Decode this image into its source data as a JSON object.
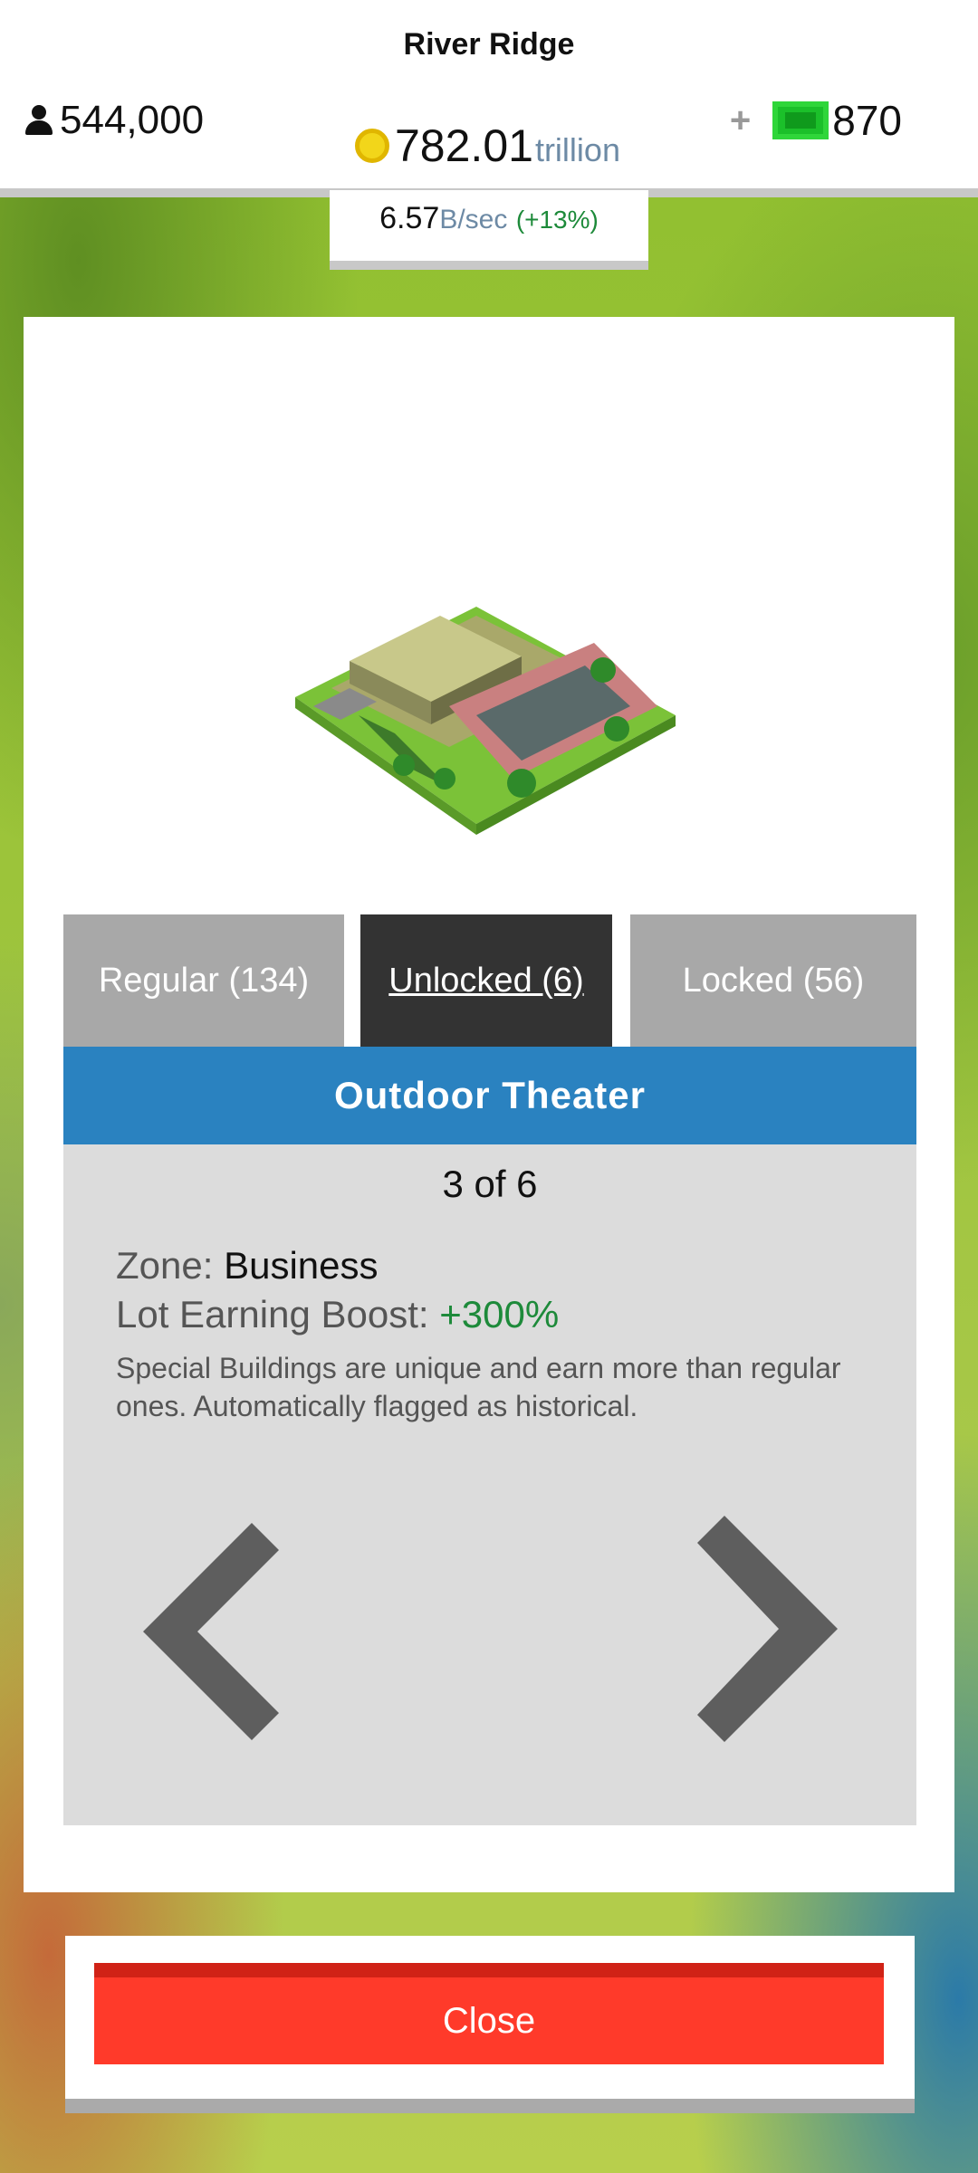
{
  "header": {
    "city_name": "River Ridge",
    "population": "544,000",
    "money_value": "782.01",
    "money_unit": "trillion",
    "gems_plus": "+",
    "gems": "870",
    "rate_value": "6.57",
    "rate_unit": "B/sec",
    "rate_pct": "(+13%)"
  },
  "tabs": {
    "regular": "Regular (134)",
    "unlocked": "Unlocked (6)",
    "locked": "Locked (56)",
    "active": "unlocked"
  },
  "building": {
    "name": "Outdoor Theater",
    "counter": "3 of 6",
    "zone_label": "Zone:",
    "zone_value": "Business",
    "boost_label": "Lot Earning Boost:",
    "boost_value": "+300%",
    "description": "Special Buildings are unique and earn more than regular ones. Automatically flagged as historical."
  },
  "close_label": "Close",
  "colors": {
    "title_bar": "#2a82c0",
    "active_tab": "#333333",
    "inactive_tab": "#a8a8a8",
    "close_button": "#ff3a2a",
    "positive": "#1d8a3a"
  },
  "icons": [
    "person-icon",
    "coin-icon",
    "cash-icon",
    "chevron-left-icon",
    "chevron-right-icon"
  ]
}
